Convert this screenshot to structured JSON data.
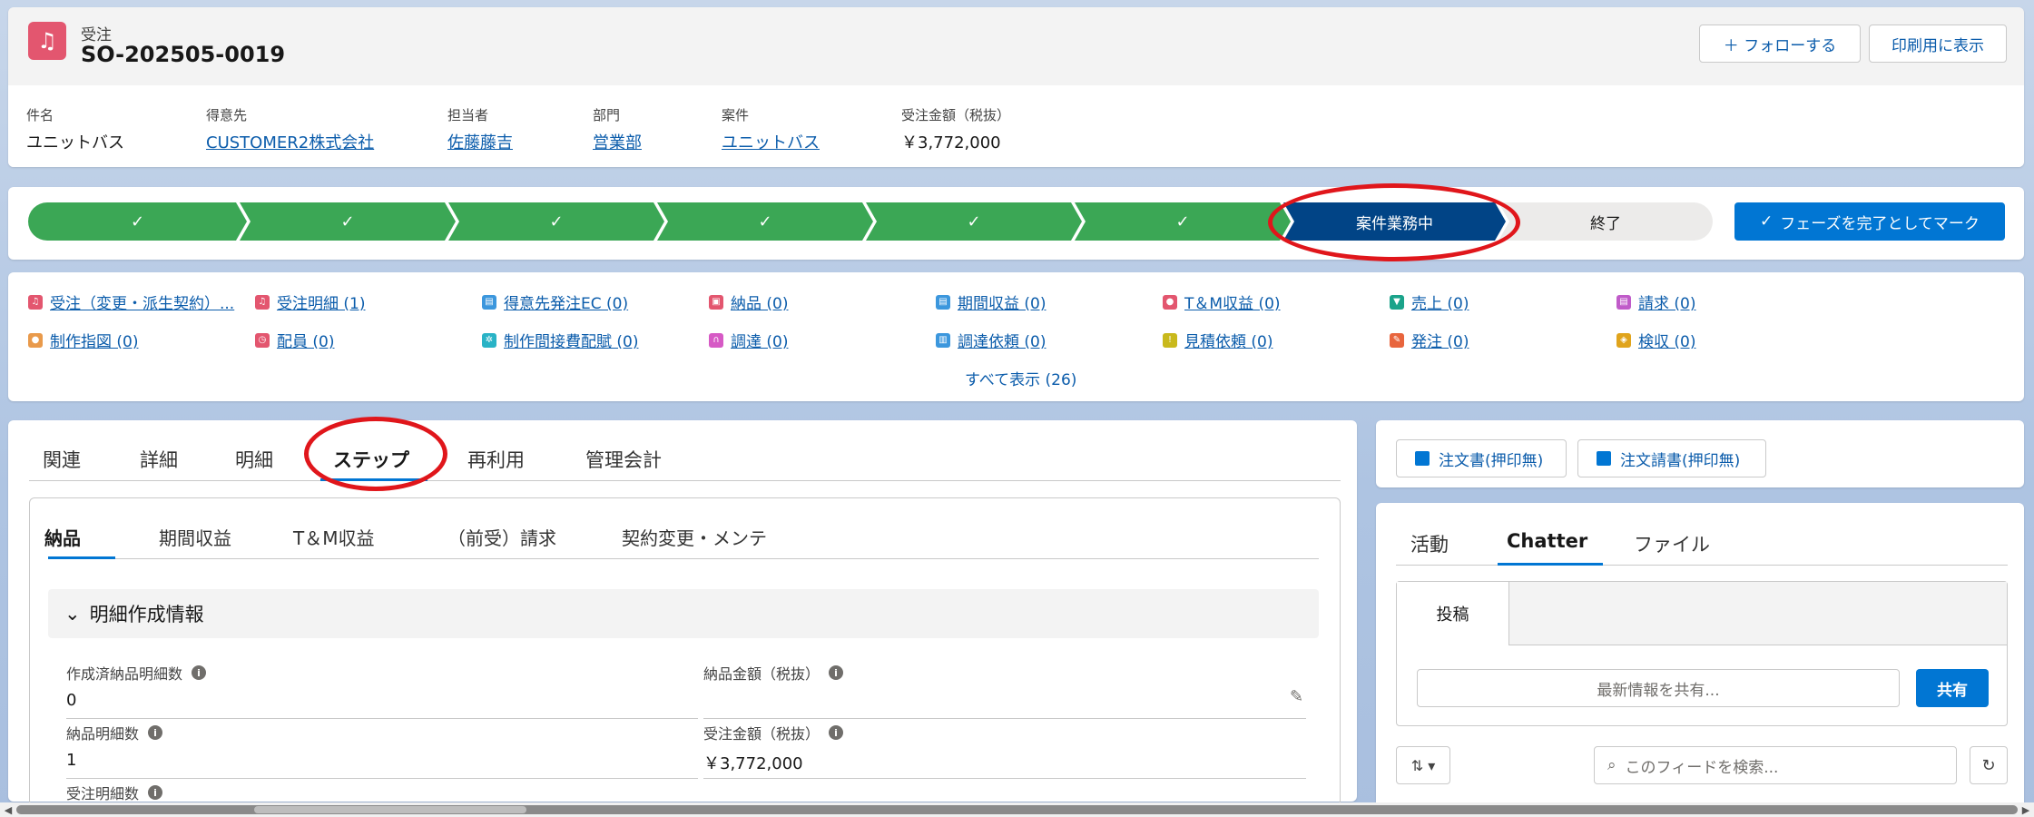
{
  "header": {
    "object_label": "受注",
    "record_name": "SO-202505-0019",
    "follow_label": "＋ フォローする",
    "print_label": "印刷用に表示",
    "fields": [
      {
        "label": "件名",
        "value": "ユニットバス",
        "link": false
      },
      {
        "label": "得意先",
        "value": "CUSTOMER2株式会社",
        "link": true
      },
      {
        "label": "担当者",
        "value": "佐藤藤吉",
        "link": true
      },
      {
        "label": "部門",
        "value": "営業部",
        "link": true
      },
      {
        "label": "案件",
        "value": "ユニットバス",
        "link": true
      },
      {
        "label": "受注金額（税抜）",
        "value": "￥3,772,000",
        "link": false
      }
    ]
  },
  "path": {
    "done_mark": "✓",
    "current": "案件業務中",
    "next": "終了",
    "mark_button": "フェーズを完了としてマーク"
  },
  "quick_links": [
    {
      "label": "受注（変更・派生契約）...",
      "color": "#e3566f"
    },
    {
      "label": "受注明細 (1)",
      "color": "#e3566f"
    },
    {
      "label": "得意先発注EC (0)",
      "color": "#3c97dd"
    },
    {
      "label": "納品 (0)",
      "color": "#e3566f"
    },
    {
      "label": "期間収益 (0)",
      "color": "#3c97dd"
    },
    {
      "label": "T＆M収益 (0)",
      "color": "#e3566f"
    },
    {
      "label": "売上 (0)",
      "color": "#1aa38a"
    },
    {
      "label": "請求 (0)",
      "color": "#c05bc9"
    },
    {
      "label": "制作指図 (0)",
      "color": "#e99a4b"
    },
    {
      "label": "配員 (0)",
      "color": "#e3566f"
    },
    {
      "label": "制作間接費配賦 (0)",
      "color": "#29b3c6"
    },
    {
      "label": "調達 (0)",
      "color": "#d65ac5"
    },
    {
      "label": "調達依頼 (0)",
      "color": "#3c97dd"
    },
    {
      "label": "見積依頼 (0)",
      "color": "#c9b91c"
    },
    {
      "label": "発注 (0)",
      "color": "#e8653d"
    },
    {
      "label": "検収 (0)",
      "color": "#e0a41c"
    }
  ],
  "show_all": "すべて表示 (26)",
  "main": {
    "tabs": [
      "関連",
      "詳細",
      "明細",
      "ステップ",
      "再利用",
      "管理会計"
    ],
    "subtabs": [
      "納品",
      "期間収益",
      "T＆M収益",
      "（前受）請求",
      "契約変更・メンテ"
    ],
    "section_title": "明細作成情報",
    "fields": {
      "created_count_label": "作成済納品明細数",
      "created_count_value": "0",
      "delivery_count_label": "納品明細数",
      "delivery_count_value": "1",
      "order_count_label": "受注明細数",
      "delivery_amount_label": "納品金額（税抜）",
      "delivery_amount_value": "",
      "order_amount_label": "受注金額（税抜）",
      "order_amount_value": "￥3,772,000"
    }
  },
  "right": {
    "btn1": "注文書(押印無)",
    "btn2": "注文請書(押印無)",
    "tabs": [
      "活動",
      "Chatter",
      "ファイル"
    ],
    "post_tab": "投稿",
    "share_placeholder": "最新情報を共有...",
    "share_button": "共有",
    "feed_search_placeholder": "このフィードを検索..."
  }
}
